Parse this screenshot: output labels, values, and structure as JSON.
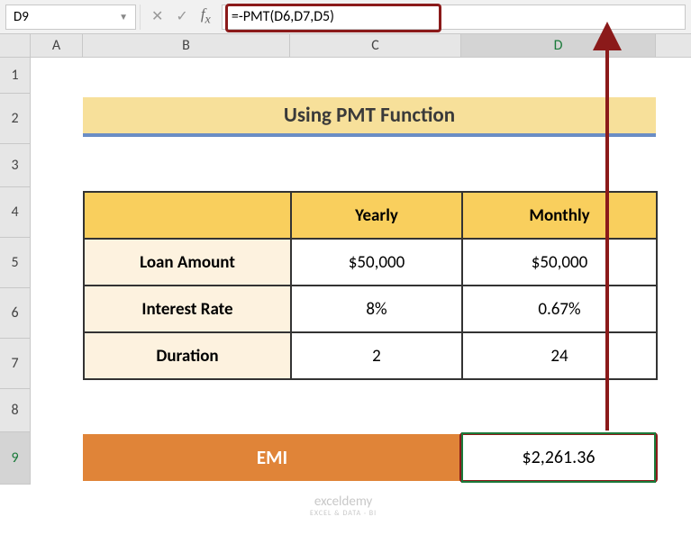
{
  "name_box": "D9",
  "formula": "=-PMT(D6,D7,D5)",
  "columns": [
    "A",
    "B",
    "C",
    "D"
  ],
  "rows": [
    "1",
    "2",
    "3",
    "4",
    "5",
    "6",
    "7",
    "8",
    "9"
  ],
  "active_col": "D",
  "active_row": "9",
  "title": "Using PMT Function",
  "table": {
    "headers": {
      "col_b": "",
      "col_c": "Yearly",
      "col_d": "Monthly"
    },
    "rows": [
      {
        "label": "Loan Amount",
        "yearly": "$50,000",
        "monthly": "$50,000"
      },
      {
        "label": "Interest Rate",
        "yearly": "8%",
        "monthly": "0.67%"
      },
      {
        "label": "Duration",
        "yearly": "2",
        "monthly": "24"
      }
    ]
  },
  "emi": {
    "label": "EMI",
    "value": "$2,261.36"
  },
  "watermark": {
    "main": "exceldemy",
    "sub": "EXCEL & DATA · BI"
  },
  "chart_data": {
    "type": "table",
    "title": "Using PMT Function",
    "categories": [
      "Loan Amount",
      "Interest Rate",
      "Duration"
    ],
    "series": [
      {
        "name": "Yearly",
        "values": [
          "$50,000",
          "8%",
          "2"
        ]
      },
      {
        "name": "Monthly",
        "values": [
          "$50,000",
          "0.67%",
          "24"
        ]
      }
    ],
    "result": {
      "label": "EMI",
      "value": 2261.36,
      "formula": "=-PMT(D6,D7,D5)"
    }
  }
}
